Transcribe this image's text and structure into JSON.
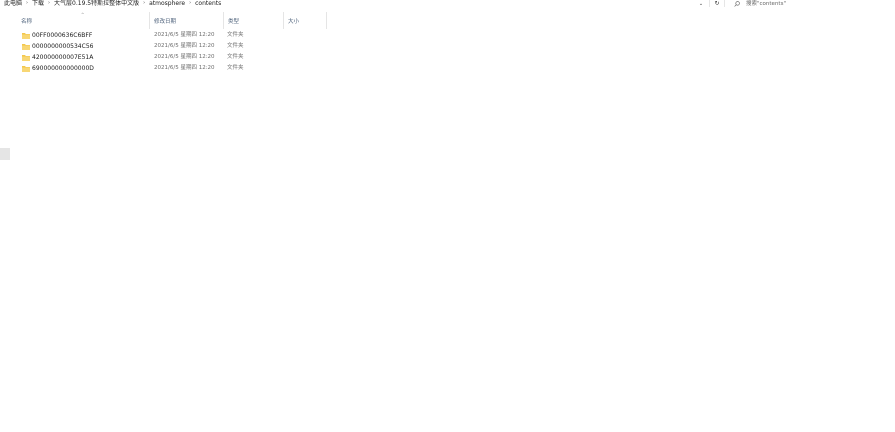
{
  "address_bar": {
    "breadcrumbs": [
      "此电脑",
      "下载",
      "大气层0.19.5特斯拉整体中文版",
      "atmosphere",
      "contents"
    ]
  },
  "search": {
    "placeholder": "搜索\"contents\""
  },
  "columns": {
    "name": "名称",
    "date_modified": "修改日期",
    "type": "类型",
    "size": "大小"
  },
  "files": [
    {
      "name": "00FF0000636C6BFF",
      "date": "2021/6/5 星期四 12:20",
      "type": "文件夹",
      "icon": "folder-icon"
    },
    {
      "name": "0000000000534C56",
      "date": "2021/6/5 星期四 12:20",
      "type": "文件夹",
      "icon": "folder-icon"
    },
    {
      "name": "420000000007E51A",
      "date": "2021/6/5 星期四 12:20",
      "type": "文件夹",
      "icon": "folder-icon"
    },
    {
      "name": "690000000000000D",
      "date": "2021/6/5 星期四 12:20",
      "type": "文件夹",
      "icon": "folder-icon"
    }
  ],
  "colors": {
    "folder": "#f3c74d",
    "header_text": "#4c607a"
  }
}
